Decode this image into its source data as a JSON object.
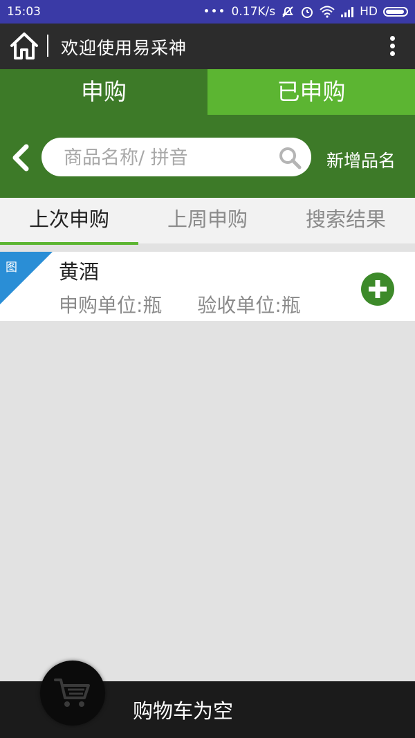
{
  "status_bar": {
    "time": "15:03",
    "net_speed": "0.17K/s",
    "network": "HD"
  },
  "header": {
    "title": "欢迎使用易采神"
  },
  "main_tabs": [
    {
      "label": "申购"
    },
    {
      "label": "已申购"
    }
  ],
  "search": {
    "placeholder": "商品名称/ 拼音",
    "value": ""
  },
  "add_name_label": "新增品名",
  "sub_tabs": [
    {
      "label": "上次申购"
    },
    {
      "label": "上周申购"
    },
    {
      "label": "搜索结果"
    }
  ],
  "items": [
    {
      "tag": "图",
      "name": "黄酒",
      "purchase_unit": "申购单位:瓶",
      "receive_unit": "验收单位:瓶"
    }
  ],
  "cart": {
    "status": "购物车为空"
  },
  "colors": {
    "status_bar": "#3a3aa6",
    "header": "#2c2c2c",
    "dark_green": "#3d7a28",
    "light_green": "#5cb532",
    "tag_blue": "#2a8ed6",
    "add_green": "#3d8a2a"
  }
}
